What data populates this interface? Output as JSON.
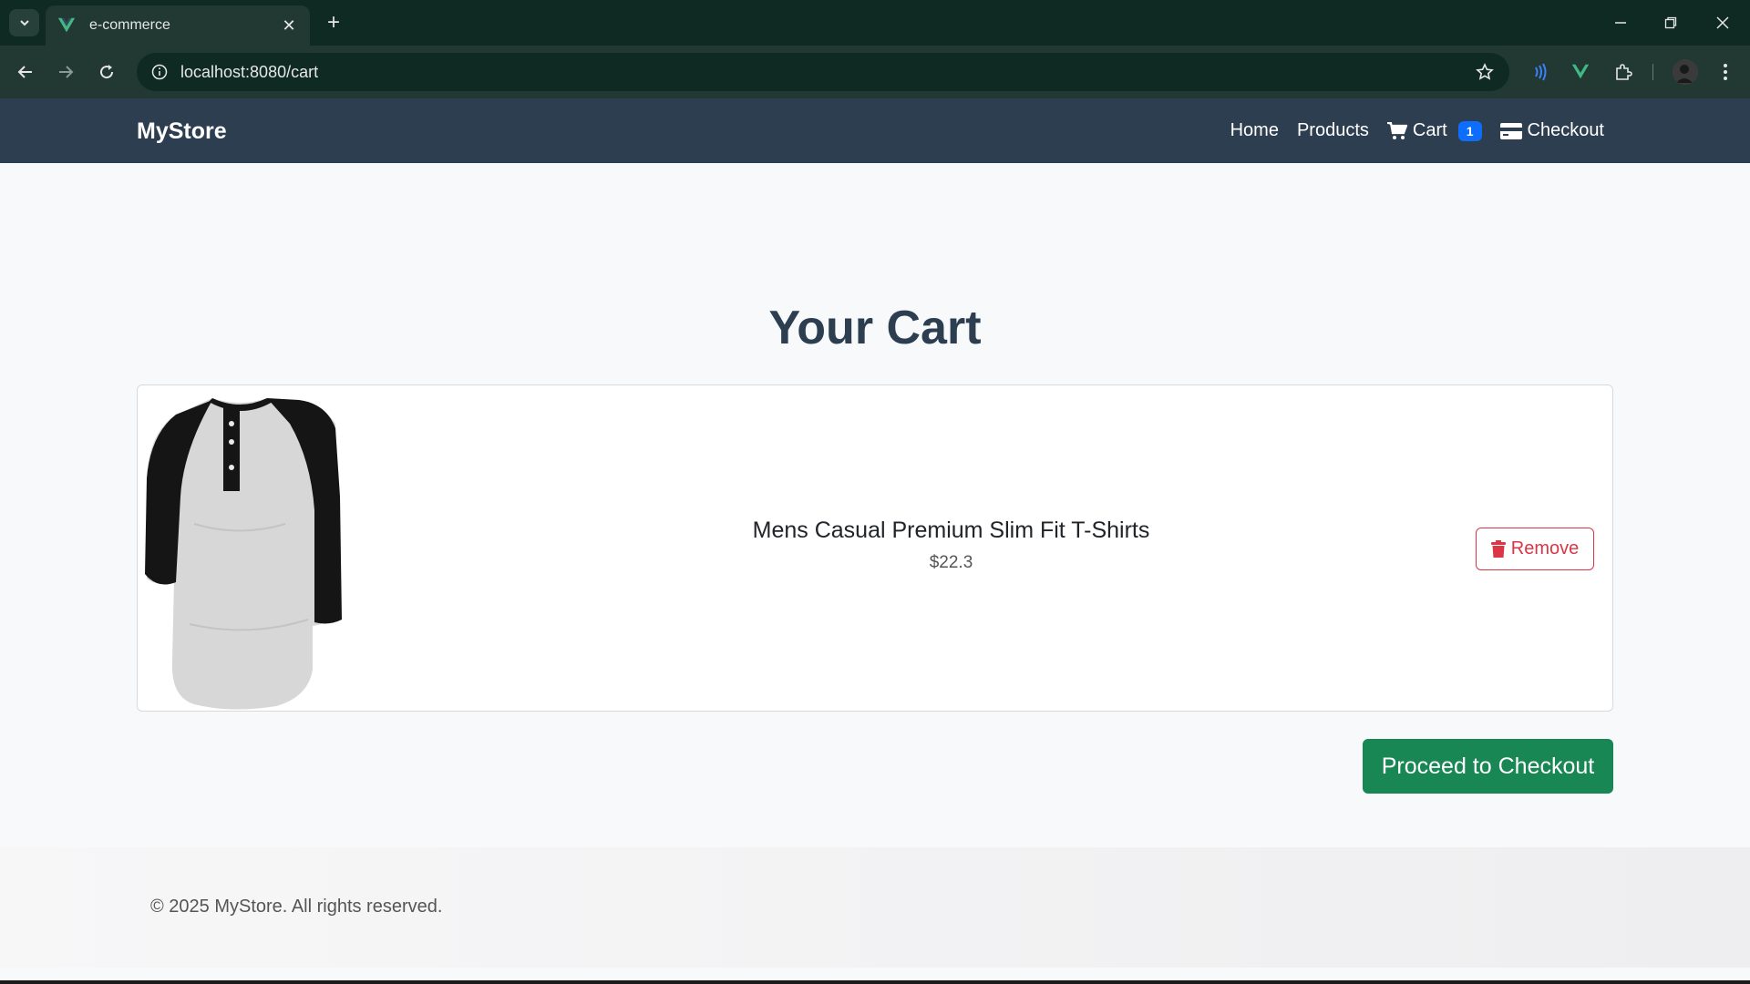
{
  "browser": {
    "tab_title": "e-commerce",
    "url": "localhost:8080/cart"
  },
  "navbar": {
    "brand": "MyStore",
    "links": {
      "home": "Home",
      "products": "Products",
      "cart": "Cart",
      "cart_count": "1",
      "checkout": "Checkout"
    }
  },
  "page": {
    "title": "Your Cart"
  },
  "cart_items": [
    {
      "name": "Mens Casual Premium Slim Fit T-Shirts",
      "price": "$22.3",
      "remove_label": "Remove"
    }
  ],
  "actions": {
    "proceed_label": "Proceed to Checkout"
  },
  "footer": {
    "text": "© 2025 MyStore. All rights reserved."
  },
  "colors": {
    "navbar": "#2c3e50",
    "badge": "#0d6efd",
    "remove": "#dc3545",
    "checkout": "#198754"
  }
}
